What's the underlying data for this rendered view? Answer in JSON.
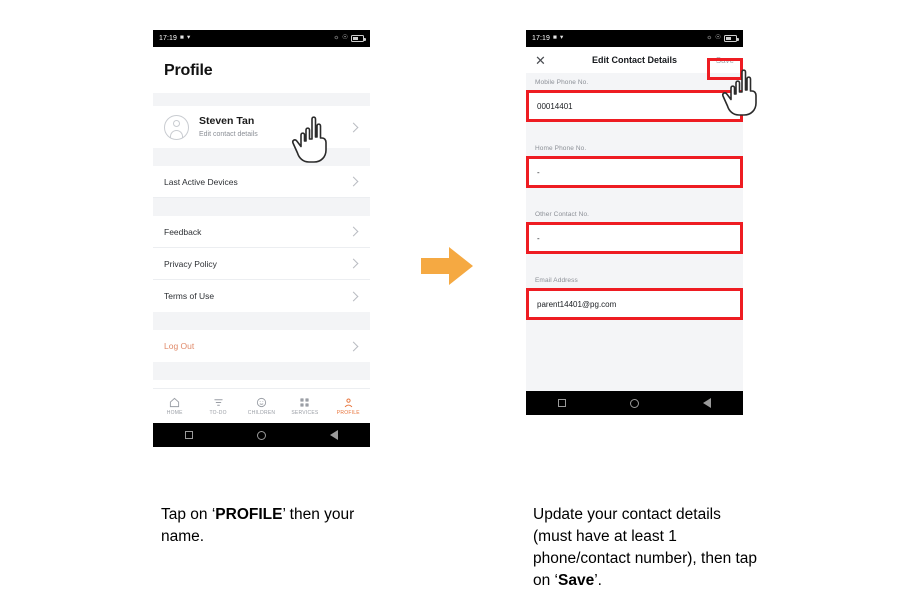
{
  "statusbar": {
    "time": "17:19",
    "left_icons": [
      "camera-icon",
      "wifi-icon"
    ],
    "right_icons": [
      "mute-icon",
      "alarm-icon",
      "battery-icon"
    ]
  },
  "left_phone": {
    "page_title": "Profile",
    "profile": {
      "name": "Steven Tan",
      "subtitle": "Edit contact details"
    },
    "menu_items": [
      {
        "label": "Last Active Devices"
      },
      {
        "label": "Feedback"
      },
      {
        "label": "Privacy Policy"
      },
      {
        "label": "Terms of Use"
      },
      {
        "label": "Log Out"
      }
    ],
    "tabbar": [
      {
        "label": "HOME",
        "icon": "home-icon",
        "active": false
      },
      {
        "label": "TO-DO",
        "icon": "list-icon",
        "active": false
      },
      {
        "label": "CHILDREN",
        "icon": "child-face-icon",
        "active": false
      },
      {
        "label": "SERVICES",
        "icon": "grid-icon",
        "active": false
      },
      {
        "label": "PROFILE",
        "icon": "person-icon",
        "active": true
      }
    ]
  },
  "right_phone": {
    "header": {
      "close_label": "✕",
      "title": "Edit Contact Details",
      "save_label": "Save"
    },
    "fields": [
      {
        "label": "Mobile Phone No.",
        "value": "00014401"
      },
      {
        "label": "Home Phone No.",
        "value": "-"
      },
      {
        "label": "Other Contact No.",
        "value": "-"
      },
      {
        "label": "Email Address",
        "value": "parent14401@pg.com"
      }
    ]
  },
  "captions": {
    "left_pre": "Tap on ‘",
    "left_bold": "PROFILE",
    "left_post": "’ then your name.",
    "right_pre": "Update your contact details (must have at least 1 phone/contact number), then tap on ‘",
    "right_bold": "Save",
    "right_post": "’."
  },
  "colors": {
    "highlight_red": "#ee1c22",
    "accent_orange": "#e8743b",
    "arrow_orange": "#f5a942",
    "logout_text": "#e08a6a",
    "panel_grey": "#f4f5f7"
  }
}
